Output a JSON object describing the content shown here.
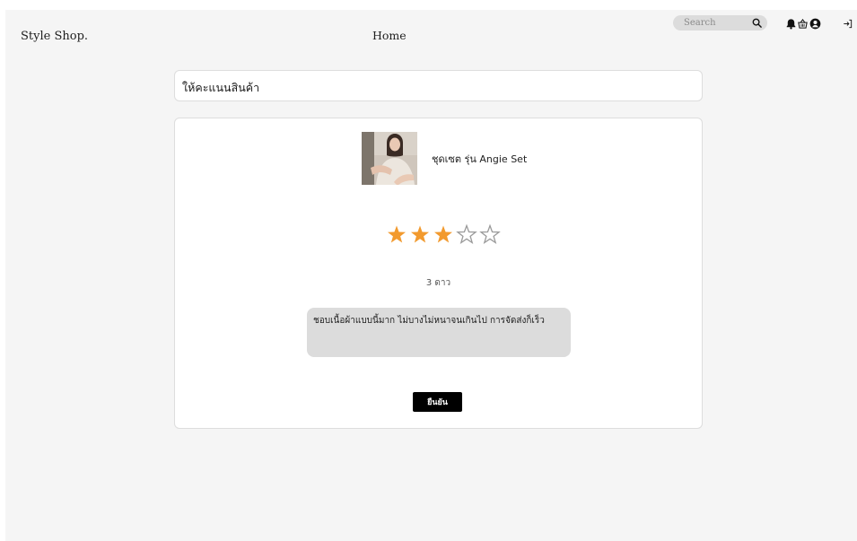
{
  "header": {
    "brand": "Style Shop.",
    "nav_home": "Home",
    "search_placeholder": "Search"
  },
  "page": {
    "title": "ให้คะแนนสินค้า"
  },
  "product": {
    "name": "ชุดเซต รุ่น Angie Set"
  },
  "rating": {
    "value": 3,
    "max": 5,
    "label": "3 ดาว",
    "filled_color": "#f29a2e",
    "empty_color": "#9a9a9a"
  },
  "review": {
    "comment": "ชอบเนื้อผ้าแบบนี้มาก ไม่บางไม่หนาจนเกินไป การจัดส่งก็เร็ว"
  },
  "actions": {
    "submit_label": "ยืนยัน"
  },
  "icons": {
    "search": "search-icon",
    "notifications": "bell-icon",
    "cart": "basket-icon",
    "account": "user-circle-icon",
    "logout": "logout-icon"
  }
}
